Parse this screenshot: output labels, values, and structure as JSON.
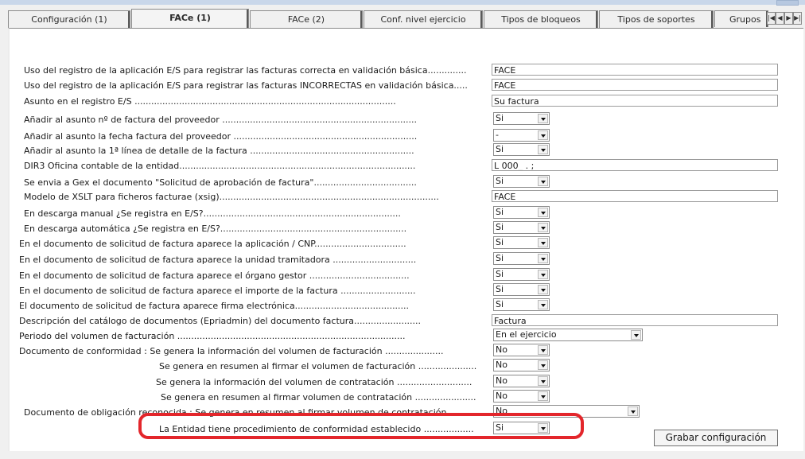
{
  "tabs": [
    {
      "label": "Configuración (1)"
    },
    {
      "label": "FACe (1)"
    },
    {
      "label": "FACe (2)"
    },
    {
      "label": "Conf. nivel ejercicio"
    },
    {
      "label": "Tipos de bloqueos"
    },
    {
      "label": "Tipos de soportes"
    },
    {
      "label": "Grupos"
    }
  ],
  "active_tab": "FACe (1)",
  "rows": [
    {
      "label": "Uso del registro de la aplicación E/S para registrar las facturas correcta en validación básica..............",
      "value": "FACE"
    },
    {
      "label": "Uso del registro de la aplicación E/S para registrar las facturas INCORRECTAS en validación básica.....",
      "value": "FACE"
    },
    {
      "label": "Asunto en el registro E/S ..............................................................................................",
      "value": "Su factura"
    },
    {
      "label": "Añadir al asunto nº de factura del proveedor ......................................................................",
      "value": "Si"
    },
    {
      "label": "Añadir al asunto la fecha factura del proveedor ..................................................................",
      "value": "-"
    },
    {
      "label": "Añadir al asunto la 1ª línea de detalle de la factura ...........................................................",
      "value": "Si"
    },
    {
      "label": "DIR3 Oficina contable de la entidad.....................................................................................",
      "value": "L 000_ . ;"
    },
    {
      "label": "Se envia a Gex el documento \"Solicitud de aprobación de factura\".....................................",
      "value": "Si"
    },
    {
      "label": "Modelo de XSLT para ficheros facturae (xsig)...............................................................................",
      "value": "FACE"
    },
    {
      "label": "En descarga manual ¿Se registra en E/S?.......................................................................",
      "value": "Si"
    },
    {
      "label": "En descarga automática ¿Se registra en E/S?...................................................................",
      "value": "Si"
    },
    {
      "label": "En el documento de solicitud de factura aparece la aplicación / CNP.................................",
      "value": "Si"
    },
    {
      "label": "En el documento de solicitud de factura aparece la unidad tramitadora ..............................",
      "value": "Si"
    },
    {
      "label": "En el documento de solicitud de factura aparece el órgano gestor ....................................",
      "value": "Si"
    },
    {
      "label": "En el documento de solicitud de factura aparece el importe de la factura ...........................",
      "value": "Si"
    },
    {
      "label": "El documento de solicitud de factura aparece firma electrónica.........................................",
      "value": "Si"
    },
    {
      "label": "Descripción del catálogo de documentos (Epriadmin) del documento factura........................",
      "value": "Factura"
    },
    {
      "label": "Periodo del volumen de facturación ..................................................................................",
      "value": "En el ejercicio"
    },
    {
      "label": "Documento de conformidad : Se genera la información del volumen de facturación .....................",
      "value": "No"
    },
    {
      "label": "Se genera en resumen al firmar el volumen de facturación .....................",
      "value": "No"
    },
    {
      "label": "Se genera la información del volumen de contratación ...........................",
      "value": "No"
    },
    {
      "label": "Se genera en resumen al firmar volumen de contratación ......................",
      "value": "No"
    },
    {
      "label": "Documento de obligación reconocida : Se genera en resumen al firmar volumen de contratación",
      "value": "No"
    },
    {
      "label": "La Entidad tiene procedimiento de conformidad establecido ..................",
      "value": "Si"
    }
  ],
  "save_button": "Grabar configuración",
  "highlight_color": "#e3262b",
  "icons": {
    "tab_nav": [
      "first-icon",
      "prev-icon",
      "next-icon",
      "last-icon"
    ],
    "dropdown": "chevron-down-icon"
  }
}
